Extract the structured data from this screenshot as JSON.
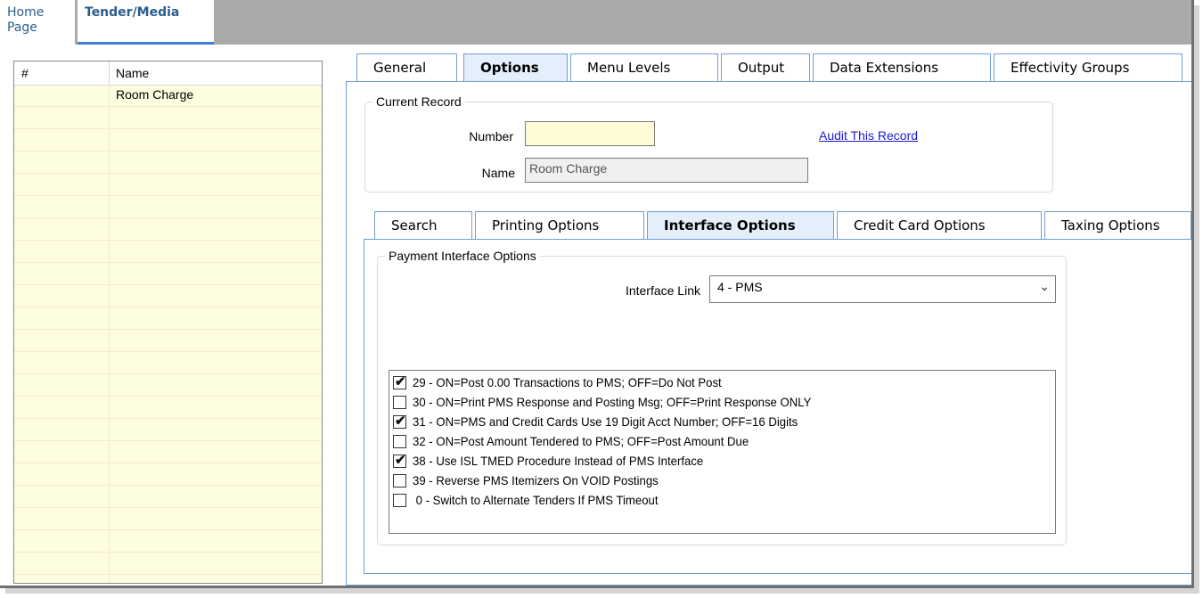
{
  "app_tabs": {
    "home": "Home\nPage",
    "tender": "Tender/Media"
  },
  "list": {
    "col_number": "#",
    "col_name": "Name",
    "rows": [
      {
        "number": "",
        "name": "Room Charge"
      }
    ]
  },
  "main_tabs": [
    "General",
    "Options",
    "Menu Levels",
    "Output",
    "Data Extensions",
    "Effectivity Groups"
  ],
  "current_record": {
    "title": "Current Record",
    "number_label": "Number",
    "number_value": "",
    "name_label": "Name",
    "name_value": "Room Charge",
    "audit_link": "Audit This Record"
  },
  "sub_tabs": [
    "Search",
    "Printing Options",
    "Interface Options",
    "Credit Card Options",
    "Taxing Options"
  ],
  "payment_interface": {
    "title": "Payment Interface Options",
    "interface_link_label": "Interface Link",
    "interface_link_value": "4 - PMS",
    "options": [
      {
        "checked": true,
        "label": "29 - ON=Post 0.00 Transactions to PMS; OFF=Do Not Post"
      },
      {
        "checked": false,
        "label": "30 - ON=Print PMS Response and Posting Msg; OFF=Print Response ONLY"
      },
      {
        "checked": true,
        "label": "31 - ON=PMS and Credit Cards Use 19 Digit Acct Number; OFF=16 Digits"
      },
      {
        "checked": false,
        "label": "32 - ON=Post Amount Tendered to PMS; OFF=Post Amount Due"
      },
      {
        "checked": true,
        "label": "38 - Use ISL TMED Procedure Instead of PMS Interface"
      },
      {
        "checked": false,
        "label": "39 - Reverse PMS Itemizers On VOID Postings"
      },
      {
        "checked": false,
        "label": " 0 - Switch to Alternate Tenders If PMS Timeout"
      }
    ]
  },
  "colors": {
    "tab_border": "#6f9fd4",
    "active_tab_bg": "#e4effb",
    "list_bg": "#fffde0",
    "link": "#1a1ad6"
  }
}
